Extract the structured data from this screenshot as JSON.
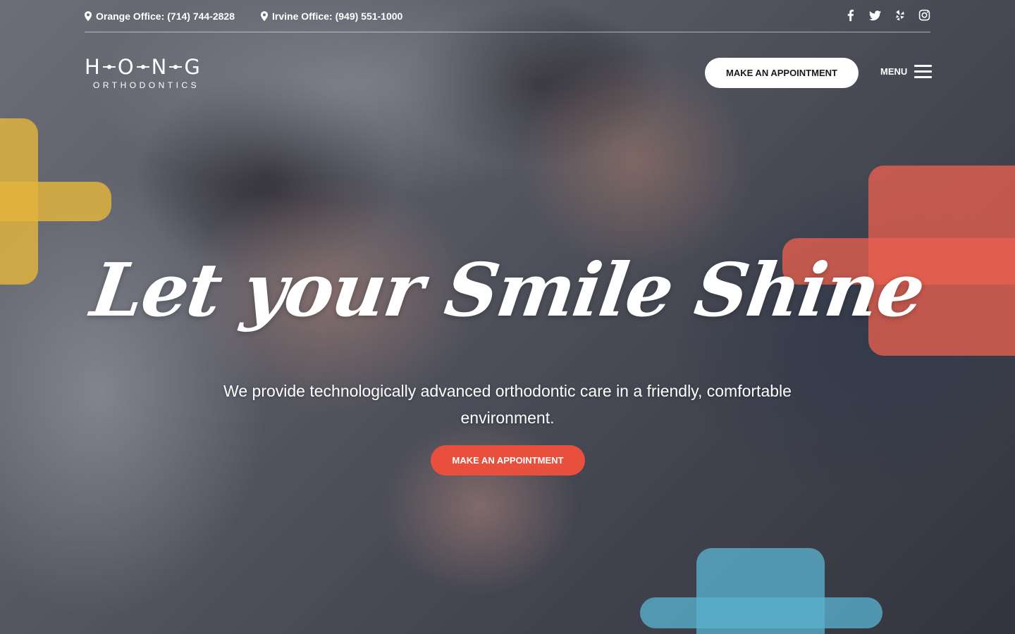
{
  "topbar": {
    "offices": [
      {
        "label": "Orange Office:",
        "phone": "(714) 744-2828",
        "icon": "map-pin-icon"
      },
      {
        "label": "Irvine Office:",
        "phone": "(949) 551-1000",
        "icon": "map-pin-icon"
      }
    ],
    "social": [
      "facebook-icon",
      "twitter-icon",
      "yelp-icon",
      "instagram-icon"
    ]
  },
  "header": {
    "logo": {
      "letters": [
        "H",
        "O",
        "N",
        "G"
      ],
      "subtitle": "ORTHODONTICS"
    },
    "cta_label": "MAKE AN APPOINTMENT",
    "menu_label": "MENU"
  },
  "hero": {
    "headline": "Let your Smile Shine",
    "subheadline": "We provide technologically advanced orthodontic care in a friendly, comfortable environment.",
    "cta_label": "MAKE AN APPOINTMENT"
  },
  "colors": {
    "accent_red": "#e8503d",
    "plus_yellow": "#e4b43c",
    "plus_red": "#e86050",
    "plus_blue": "#5aafcd"
  }
}
